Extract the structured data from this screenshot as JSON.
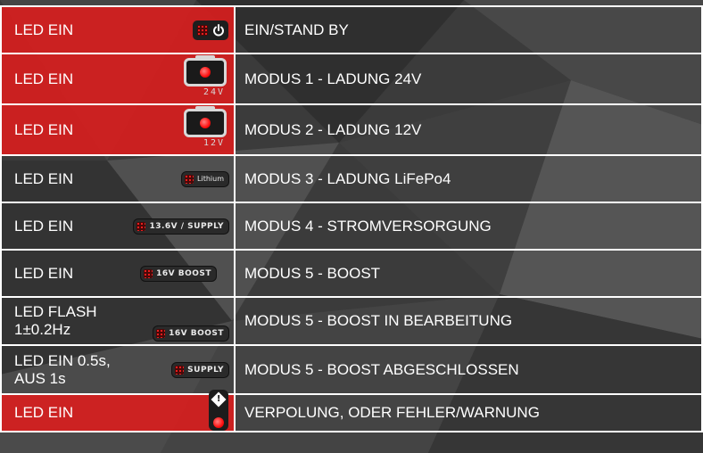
{
  "colors": {
    "row_red": "#d71e1e",
    "border": "#ffffff",
    "text": "#ffffff"
  },
  "rows": [
    {
      "state": "LED EIN",
      "icon": "power-led-icon",
      "mode": "EIN/STAND BY"
    },
    {
      "state": "LED EIN",
      "icon": "battery-24v-icon",
      "icon_text": "24V",
      "mode": "MODUS 1 - LADUNG 24V"
    },
    {
      "state": "LED EIN",
      "icon": "battery-12v-icon",
      "icon_text": "12V",
      "mode": "MODUS 2 - LADUNG 12V"
    },
    {
      "state": "LED EIN",
      "icon": "lithium-led-icon",
      "icon_text": "Lithium",
      "mode": "MODUS 3 - LADUNG LiFePo4"
    },
    {
      "state": "LED EIN",
      "icon": "supply-13-6v-led-icon",
      "icon_text": "13.6V / SUPPLY",
      "mode": "MODUS 4 - STROMVERSORGUNG"
    },
    {
      "state": "LED EIN",
      "icon": "boost-16v-led-icon",
      "icon_text": "16V BOOST",
      "mode": "MODUS 5 - BOOST"
    },
    {
      "state": "LED FLASH\n 1±0.2Hz",
      "icon": "boost-16v-led-icon",
      "icon_text": "16V BOOST",
      "mode": "MODUS 5 - BOOST IN BEARBEITUNG"
    },
    {
      "state": "LED EIN 0.5s,\nAUS 1s",
      "icon": "supply-led-icon",
      "icon_text": "SUPPLY",
      "mode": "MODUS 5 - BOOST ABGESCHLOSSEN"
    },
    {
      "state": "LED EIN",
      "icon": "warning-led-icon",
      "mode": "VERPOLUNG, ODER FEHLER/WARNUNG"
    }
  ]
}
